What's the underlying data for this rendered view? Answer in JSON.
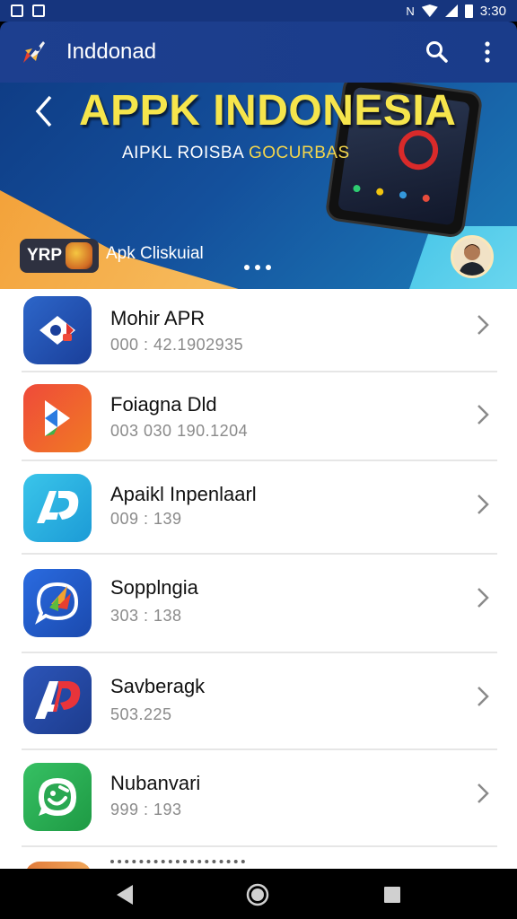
{
  "status_bar": {
    "time": "3:30",
    "icons": [
      "screenshot-icon",
      "image-icon",
      "mute-icon",
      "wifi-icon",
      "signal-icon",
      "battery-icon"
    ]
  },
  "app_bar": {
    "title": "Inddonad",
    "logo": "rocket-logo",
    "actions": [
      "search-icon",
      "more-vert-icon"
    ]
  },
  "banner": {
    "title": "APPK INDONESIA",
    "subtitle_white": "AIPKL ROISBA",
    "subtitle_highlight": "GOCURBAS",
    "promo_pill": "YRP",
    "promo_text": "Apk Cliskuial",
    "carousel_pages": 3
  },
  "apps": [
    {
      "name": "Mohir APR",
      "meta": "000 : 42.1902935",
      "icon": "picture-share-icon"
    },
    {
      "name": "Foiagna Dld",
      "meta": "003 030 190.1204",
      "icon": "play-d-icon"
    },
    {
      "name": "Apaikl Inpenlaarl",
      "meta": "009 : 139",
      "icon": "ap-cyan-icon"
    },
    {
      "name": "Sopplngia",
      "meta": "303 : 138",
      "icon": "chat-bird-icon"
    },
    {
      "name": "Savberagk",
      "meta": "503.225",
      "icon": "ap-red-icon"
    },
    {
      "name": "Nubanvari",
      "meta": "999 : 193",
      "icon": "smile-chat-icon"
    }
  ],
  "colors": {
    "app_bar": "#1d3f8f",
    "banner_title": "#f6e54c",
    "list_bg": "#ffffff",
    "meta_text": "#8a8a8a"
  },
  "nav": [
    "back-icon",
    "home-icon",
    "recents-icon"
  ]
}
